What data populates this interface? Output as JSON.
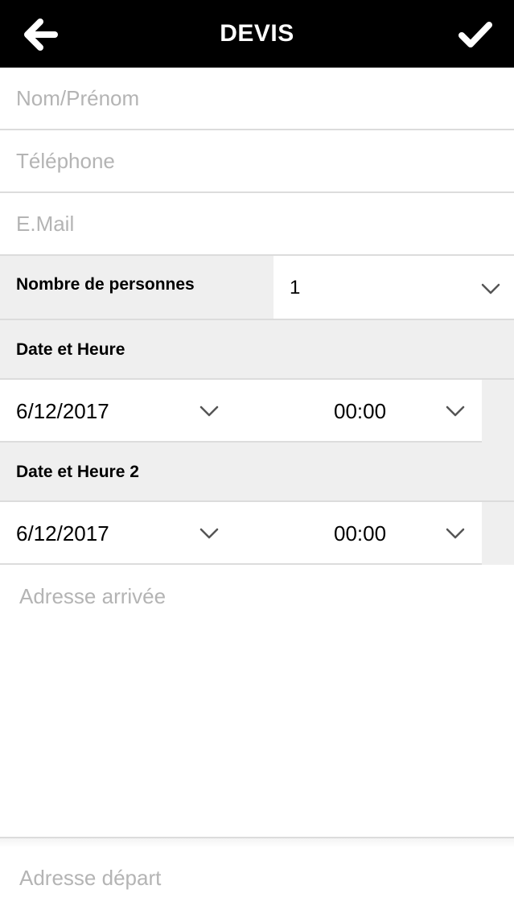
{
  "header": {
    "title": "DEVIS",
    "back_icon": "arrow-left-icon",
    "confirm_icon": "checkmark-icon"
  },
  "form": {
    "name_placeholder": "Nom/Prénom",
    "phone_placeholder": "Téléphone",
    "email_placeholder": "E.Mail",
    "persons": {
      "label": "Nombre de personnes",
      "value": "1"
    },
    "datetime1": {
      "label": "Date et Heure",
      "date": "6/12/2017",
      "time": "00:00"
    },
    "datetime2": {
      "label": "Date et Heure 2",
      "date": "6/12/2017",
      "time": "00:00"
    },
    "arrival_placeholder": "Adresse arrivée",
    "departure_placeholder": "Adresse départ"
  },
  "colors": {
    "header_bg": "#000000",
    "header_text": "#ffffff",
    "section_bg": "#efefef",
    "placeholder": "#b4b4b4",
    "divider": "#dcdcdc"
  }
}
